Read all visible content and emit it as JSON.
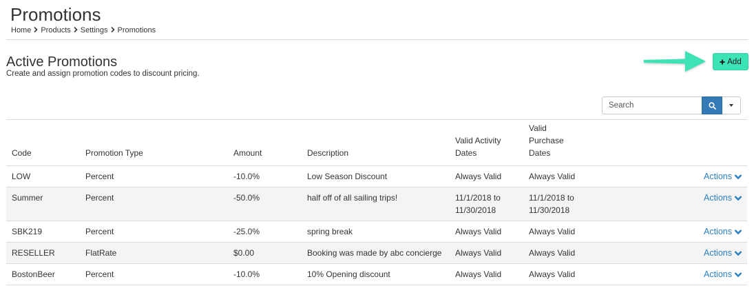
{
  "header": {
    "title": "Promotions",
    "breadcrumb": [
      "Home",
      "Products",
      "Settings",
      "Promotions"
    ]
  },
  "section": {
    "title": "Active Promotions",
    "subtitle": "Create and assign promotion codes to discount pricing."
  },
  "toolbar": {
    "add_label": "Add",
    "add_icon": "plus-icon",
    "search_placeholder": "Search",
    "search_icon": "search-icon",
    "accent_color": "#3ce3b4",
    "arrow_color": "#3ce3b4"
  },
  "table": {
    "columns": {
      "code": "Code",
      "type": "Promotion Type",
      "amount": "Amount",
      "description": "Description",
      "activity_1": "Valid Activity",
      "activity_2": "Dates",
      "purchase_1": "Valid",
      "purchase_2": "Purchase",
      "purchase_3": "Dates"
    },
    "rows": [
      {
        "code": "LOW",
        "type": "Percent",
        "amount": "-10.0%",
        "description": "Low Season Discount",
        "activity_1": "Always Valid",
        "activity_2": "",
        "purchase_1": "Always Valid",
        "purchase_2": "",
        "actions": "Actions"
      },
      {
        "code": "Summer",
        "type": "Percent",
        "amount": "-50.0%",
        "description": "half off of all sailing trips!",
        "activity_1": "11/1/2018 to",
        "activity_2": "11/30/2018",
        "purchase_1": "11/1/2018 to",
        "purchase_2": "11/30/2018",
        "actions": "Actions"
      },
      {
        "code": "SBK219",
        "type": "Percent",
        "amount": "-25.0%",
        "description": "spring break",
        "activity_1": "Always Valid",
        "activity_2": "",
        "purchase_1": "Always Valid",
        "purchase_2": "",
        "actions": "Actions"
      },
      {
        "code": "RESELLER",
        "type": "FlatRate",
        "amount": "$0.00",
        "description": "Booking was made by abc concierge",
        "activity_1": "Always Valid",
        "activity_2": "",
        "purchase_1": "Always Valid",
        "purchase_2": "",
        "actions": "Actions"
      },
      {
        "code": "BostonBeer",
        "type": "Percent",
        "amount": "-10.0%",
        "description": "10% Opening discount",
        "activity_1": "Always Valid",
        "activity_2": "",
        "purchase_1": "Always Valid",
        "purchase_2": "",
        "actions": "Actions"
      }
    ]
  }
}
